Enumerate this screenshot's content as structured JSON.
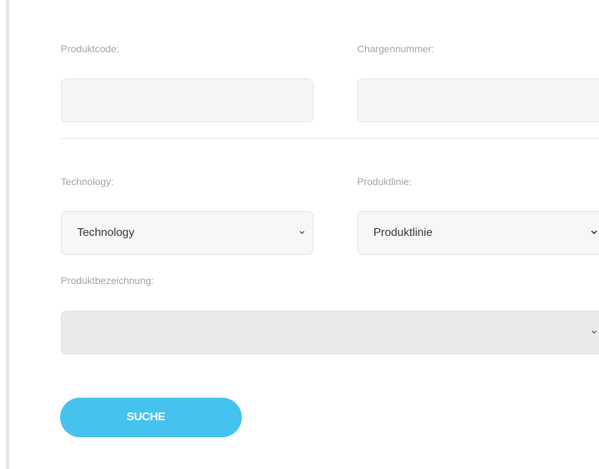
{
  "form": {
    "product_code": {
      "label": "Produktcode:",
      "value": ""
    },
    "batch_number": {
      "label": "Chargennummer:",
      "value": ""
    },
    "technology": {
      "label": "Technology:",
      "selected": "Technology"
    },
    "product_line": {
      "label": "Produktlinie:",
      "selected": "Produktlinie"
    },
    "product_name": {
      "label": "Produktbezeichnung:",
      "selected": "",
      "disabled": true
    },
    "search_button_label": "SUCHE"
  },
  "colors": {
    "accent": "#45c3ee",
    "label": "#a3a3a3",
    "field_bg": "#f6f6f6",
    "disabled_bg": "#eaeaea"
  },
  "icons": {
    "dropdown": "chevron-down-icon"
  }
}
